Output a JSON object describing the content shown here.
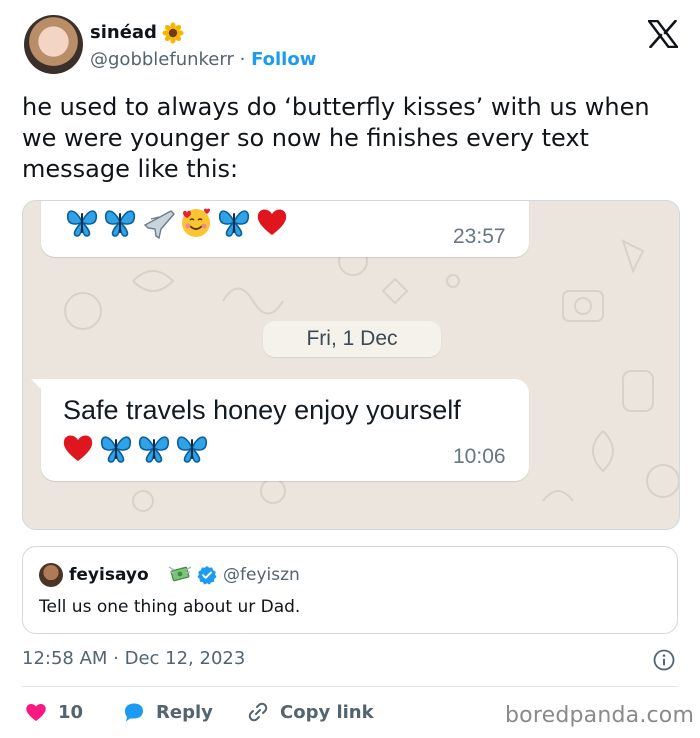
{
  "author": {
    "display_name": "sinéad",
    "name_emoji": "sunflower-emoji",
    "handle": "@gobblefunkerr",
    "separator": "·",
    "follow_label": "Follow"
  },
  "platform_logo": "x-logo",
  "tweet": {
    "text": "he used to always do ‘butterfly kisses’ with us when we were younger so now he finishes every text message like this:"
  },
  "media": {
    "message1": {
      "emojis": [
        "butterfly",
        "butterfly",
        "airplane",
        "smiling-face-with-hearts",
        "butterfly",
        "red-heart"
      ],
      "time": "23:57"
    },
    "date_chip": "Fri, 1 Dec",
    "message2": {
      "text": "Safe travels honey enjoy yourself",
      "emojis": [
        "red-heart",
        "butterfly",
        "butterfly",
        "butterfly"
      ],
      "time": "10:06"
    }
  },
  "quote": {
    "name": "feyisayo",
    "name_emoji": "money-with-wings-emoji",
    "verified": true,
    "handle": "@feyiszn",
    "text": "Tell us one thing about ur Dad."
  },
  "timestamp": "12:58 AM · Dec 12, 2023",
  "actions": {
    "like_count": "10",
    "reply_label": "Reply",
    "copy_label": "Copy link"
  },
  "watermark": "boredpanda.com",
  "colors": {
    "link": "#1d9bf0",
    "heart": "#f91880",
    "secondary_text": "#536471",
    "chat_background": "#ece5dd"
  }
}
